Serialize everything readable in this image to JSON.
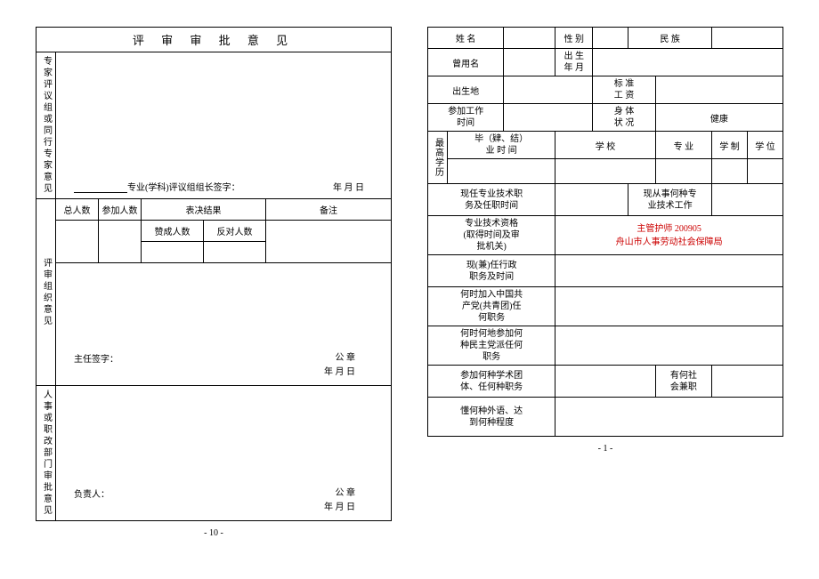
{
  "left": {
    "title": "评 审 审 批 意 见",
    "expert_label": "专家评议组或同行专家意见",
    "expert_sign_prefix": "专业(学科)评议组组长签字：",
    "date_ymd": "年    月    日",
    "review_label": "评审组织意见",
    "cols": {
      "total": "总人数",
      "attend": "参加人数",
      "vote_result": "表决结果",
      "note": "备注",
      "agree": "赞成人数",
      "oppose": "反对人数"
    },
    "seal": "公    章",
    "chair_sign": "主任签字：",
    "hr_label": "人事或职改部门审批意见",
    "responsible": "负责人：",
    "page_no": "- 10 -"
  },
  "right": {
    "name": "姓  名",
    "gender": "性  别",
    "nation": "民  族",
    "former_name": "曾用名",
    "birth": "出 生\n年 月",
    "birthplace": "出生地",
    "salary": "标 准\n工 资",
    "work_time": "参加工作\n时间",
    "health_label": "身 体\n状 况",
    "health_value": "健康",
    "edu_label": "最高学历",
    "grad_time": "毕（肄、结）\n业 时 间",
    "school": "学    校",
    "major": "专 业",
    "system": "学 制",
    "degree": "学 位",
    "current_title": "现任专业技术职\n务及任职时间",
    "current_work": "现从事何种专\n业技术工作",
    "qual_label": "专业技术资格\n(取得时间及审\n批机关)",
    "qual_value_1": "主管护师   200905",
    "qual_value_2": "舟山市人事劳动社会保障局",
    "admin": "现(兼)任行政\n职务及时间",
    "party": "何时加入中国共\n产党(共青团)任\n何职务",
    "dem_party": "何时何地参加何\n种民主党派任何\n职务",
    "society": "参加何种学术团\n体、任何种职务",
    "part_time": "有何社\n会兼职",
    "language": "懂何种外语、达\n到何种程度",
    "page_no": "- 1 -"
  }
}
